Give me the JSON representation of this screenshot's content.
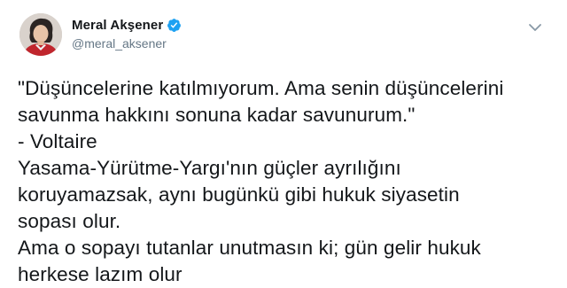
{
  "author": {
    "display_name": "Meral Akşener",
    "handle": "@meral_aksener",
    "verified": true,
    "verified_icon": "verified-badge-icon",
    "avatar_icon": "profile-photo"
  },
  "menu": {
    "icon": "chevron-down-icon"
  },
  "tweet": {
    "lines": [
      "\"Düşüncelerine katılmıyorum. Ama senin düşüncelerini",
      "savunma hakkını sonuna kadar savunurum.\"",
      "- Voltaire",
      "Yasama-Yürütme-Yargı'nın güçler ayrılığını",
      "koruyamazsak, aynı bugünkü gibi hukuk siyasetin",
      "sopası olur.",
      "Ama o sopayı tutanlar unutmasın ki; gün gelir hukuk",
      "herkese lazım olur"
    ]
  },
  "colors": {
    "text": "#14171a",
    "secondary": "#657786",
    "verified": "#1da1f2"
  }
}
